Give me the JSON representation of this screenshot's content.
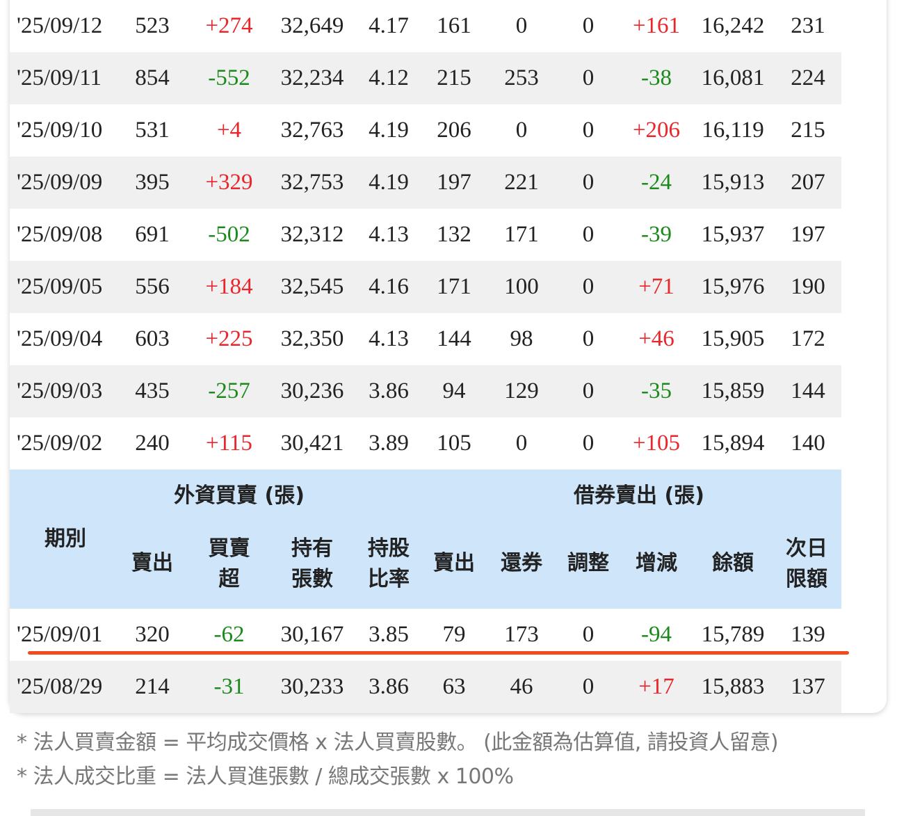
{
  "rows_top": [
    {
      "date": "'25/09/12",
      "sell": "523",
      "net": "+274",
      "hold": "32,649",
      "ratio": "4.17",
      "short_sell": "161",
      "repay": "0",
      "adjust": "0",
      "change": "+161",
      "balance": "16,242",
      "limit": "231"
    },
    {
      "date": "'25/09/11",
      "sell": "854",
      "net": "-552",
      "hold": "32,234",
      "ratio": "4.12",
      "short_sell": "215",
      "repay": "253",
      "adjust": "0",
      "change": "-38",
      "balance": "16,081",
      "limit": "224"
    },
    {
      "date": "'25/09/10",
      "sell": "531",
      "net": "+4",
      "hold": "32,763",
      "ratio": "4.19",
      "short_sell": "206",
      "repay": "0",
      "adjust": "0",
      "change": "+206",
      "balance": "16,119",
      "limit": "215"
    },
    {
      "date": "'25/09/09",
      "sell": "395",
      "net": "+329",
      "hold": "32,753",
      "ratio": "4.19",
      "short_sell": "197",
      "repay": "221",
      "adjust": "0",
      "change": "-24",
      "balance": "15,913",
      "limit": "207"
    },
    {
      "date": "'25/09/08",
      "sell": "691",
      "net": "-502",
      "hold": "32,312",
      "ratio": "4.13",
      "short_sell": "132",
      "repay": "171",
      "adjust": "0",
      "change": "-39",
      "balance": "15,937",
      "limit": "197"
    },
    {
      "date": "'25/09/05",
      "sell": "556",
      "net": "+184",
      "hold": "32,545",
      "ratio": "4.16",
      "short_sell": "171",
      "repay": "100",
      "adjust": "0",
      "change": "+71",
      "balance": "15,976",
      "limit": "190"
    },
    {
      "date": "'25/09/04",
      "sell": "603",
      "net": "+225",
      "hold": "32,350",
      "ratio": "4.13",
      "short_sell": "144",
      "repay": "98",
      "adjust": "0",
      "change": "+46",
      "balance": "15,905",
      "limit": "172"
    },
    {
      "date": "'25/09/03",
      "sell": "435",
      "net": "-257",
      "hold": "30,236",
      "ratio": "3.86",
      "short_sell": "94",
      "repay": "129",
      "adjust": "0",
      "change": "-35",
      "balance": "15,859",
      "limit": "144"
    },
    {
      "date": "'25/09/02",
      "sell": "240",
      "net": "+115",
      "hold": "30,421",
      "ratio": "3.89",
      "short_sell": "105",
      "repay": "0",
      "adjust": "0",
      "change": "+105",
      "balance": "15,894",
      "limit": "140"
    }
  ],
  "header": {
    "group_foreign": "外資買賣 (張)",
    "group_short": "借券賣出 (張)",
    "period": "期別",
    "sell": "賣出",
    "net_1": "買賣",
    "net_2": "超",
    "hold_1": "持有",
    "hold_2": "張數",
    "ratio_1": "持股",
    "ratio_2": "比率",
    "short_sell": "賣出",
    "repay": "還券",
    "adjust": "調整",
    "change": "增減",
    "balance": "餘額",
    "limit_1": "次日",
    "limit_2": "限額"
  },
  "rows_bottom": [
    {
      "date": "'25/09/01",
      "sell": "320",
      "net": "-62",
      "hold": "30,167",
      "ratio": "3.85",
      "short_sell": "79",
      "repay": "173",
      "adjust": "0",
      "change": "-94",
      "balance": "15,789",
      "limit": "139"
    },
    {
      "date": "'25/08/29",
      "sell": "214",
      "net": "-31",
      "hold": "30,233",
      "ratio": "3.86",
      "short_sell": "63",
      "repay": "46",
      "adjust": "0",
      "change": "+17",
      "balance": "15,883",
      "limit": "137"
    }
  ],
  "notes": [
    "* 法人買賣金額 = 平均成交價格 x 法人買賣股數。 (此金額為估算值, 請投資人留意)",
    "* 法人成交比重 = 法人買進張數 / 總成交張數 x 100%"
  ],
  "colors": {
    "positive": "#e8262b",
    "negative": "#1b8a1b",
    "header_bg": "#cfe5fa",
    "highlight_line": "#f24a1c"
  }
}
